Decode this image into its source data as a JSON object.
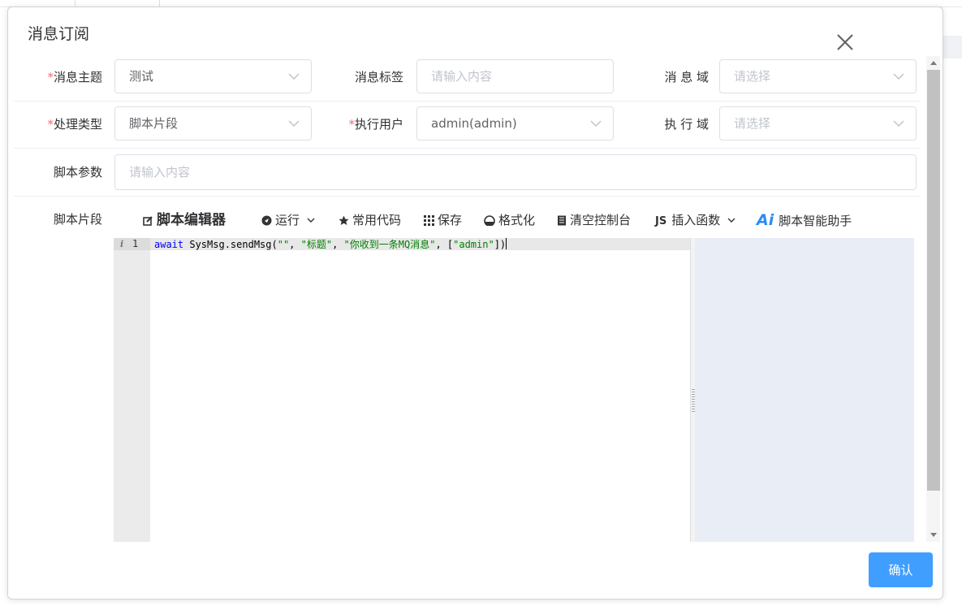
{
  "dialog": {
    "title": "消息订阅",
    "confirm_label": "确认"
  },
  "form": {
    "topic": {
      "label": "消息主题",
      "required": true,
      "value": "测试"
    },
    "tag": {
      "label": "消息标签",
      "placeholder": "请输入内容"
    },
    "domain": {
      "label": "消 息 域",
      "placeholder": "请选择"
    },
    "handler_type": {
      "label": "处理类型",
      "required": true,
      "value": "脚本片段"
    },
    "exec_user": {
      "label": "执行用户",
      "required": true,
      "value": "admin(admin)"
    },
    "exec_domain": {
      "label": "执 行 域",
      "placeholder": "请选择"
    },
    "script_params": {
      "label": "脚本参数",
      "placeholder": "请输入内容"
    },
    "script_snippet": {
      "label": "脚本片段"
    }
  },
  "toolbar": {
    "title": "脚本编辑器",
    "run": "运行",
    "common_code": "常用代码",
    "save": "保存",
    "format": "格式化",
    "clear_console": "清空控制台",
    "insert_function": "插入函数",
    "insert_prefix": "JS",
    "ai_assistant": "脚本智能助手",
    "ai_logo": "Ai"
  },
  "editor": {
    "line_number": "1",
    "line_info": "i",
    "code_kw": "await",
    "code_obj": " SysMsg.sendMsg(",
    "code_str1": "\"\"",
    "code_sep1": ", ",
    "code_str2": "\"标题\"",
    "code_sep2": ", ",
    "code_str3": "\"你收到一条MQ消息\"",
    "code_sep3": ", [",
    "code_str4": "\"admin\"",
    "code_end": "])"
  },
  "colors": {
    "accent": "#409eff",
    "required": "#f56c6c",
    "console_bg": "#e8edf6"
  }
}
